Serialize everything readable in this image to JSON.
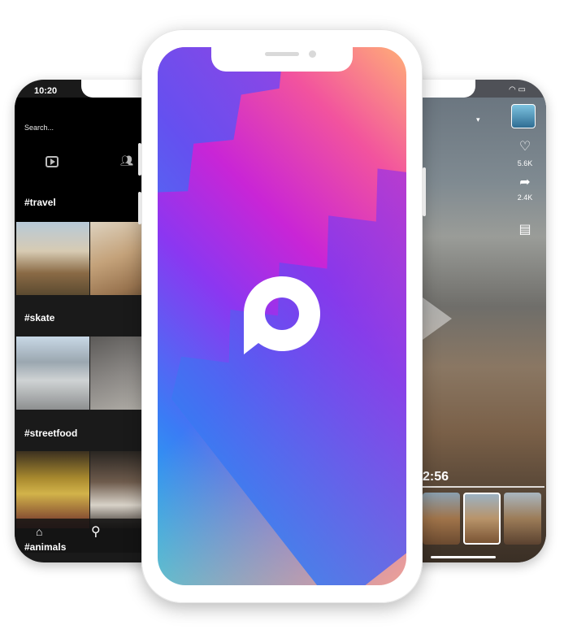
{
  "left_phone": {
    "status_time": "10:20",
    "search_placeholder": "Search...",
    "tags": [
      "#travel",
      "#skate",
      "#streetfood",
      "#animals"
    ],
    "icons": {
      "tab_video": "video-play-icon",
      "tab_users": "users-icon",
      "home": "home-icon",
      "search": "search-icon"
    }
  },
  "center_phone": {
    "logo_icon": "chat-bubble-logo-icon",
    "gradient_colors": [
      "#1ec8e8",
      "#3a7cf5",
      "#8b37f1",
      "#c925d6",
      "#f2539e",
      "#ffae77"
    ]
  },
  "right_phone": {
    "like_count": "5.6K",
    "share_count": "2.4K",
    "timecode": "2:56",
    "icons": {
      "like": "heart-icon",
      "share": "share-arrow-icon",
      "comment": "comment-icon",
      "dropdown": "caret-down-icon",
      "status": "wifi-battery-icon"
    }
  }
}
